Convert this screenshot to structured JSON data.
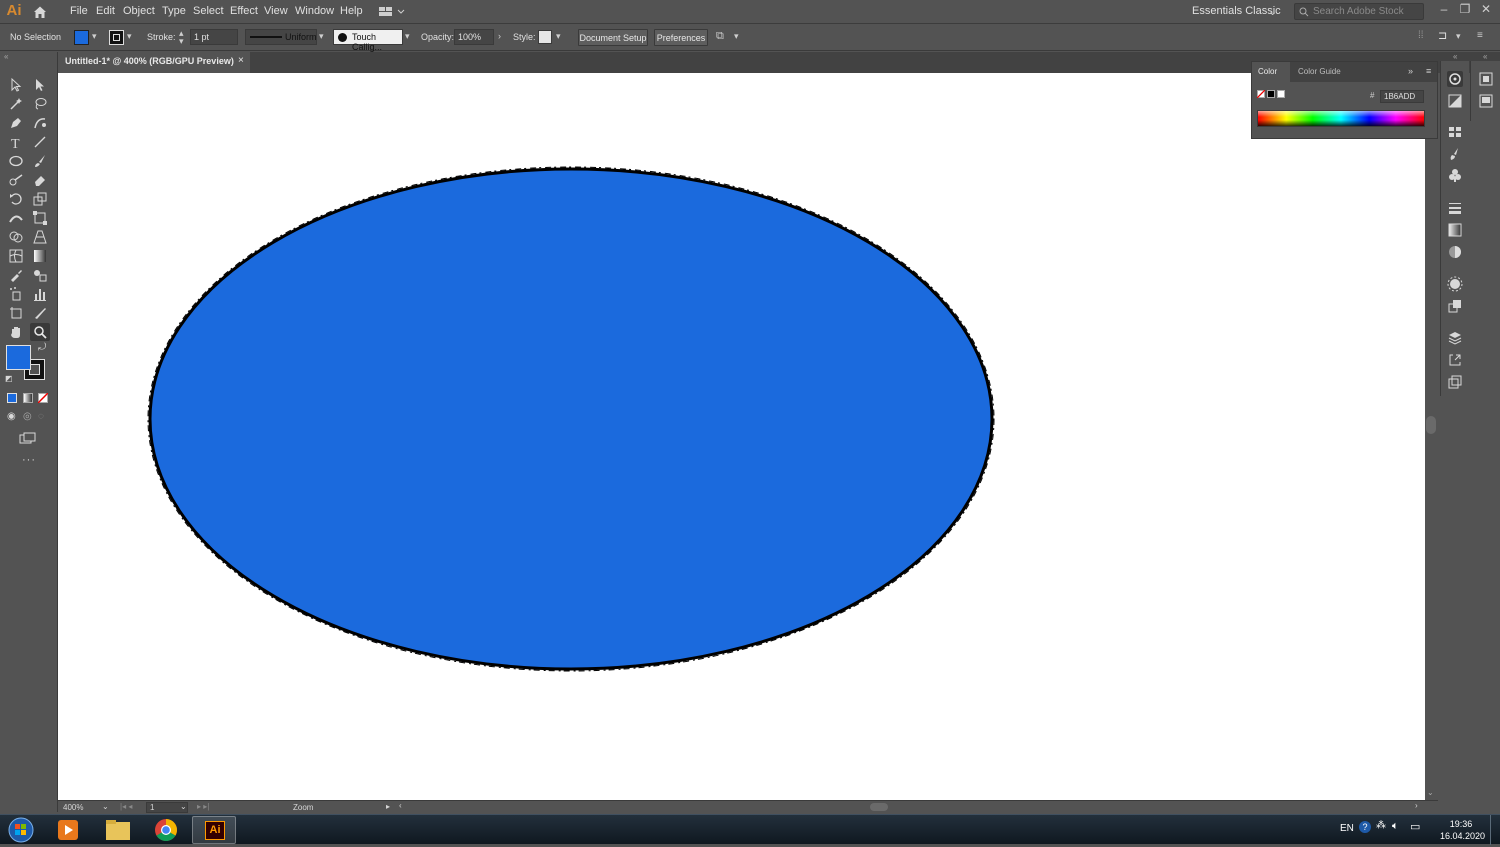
{
  "app": {
    "logo_text": "Ai",
    "menu": [
      "File",
      "Edit",
      "Object",
      "Type",
      "Select",
      "Effect",
      "View",
      "Window",
      "Help"
    ],
    "workspace": "Essentials Classic",
    "search_placeholder": "Search Adobe Stock"
  },
  "control_bar": {
    "selection_label": "No Selection",
    "fill_color": "#1B6ADD",
    "stroke_label": "Stroke:",
    "stroke_weight": "1 pt",
    "stroke_profile": "Uniform",
    "brush": "Touch Callig...",
    "opacity_label": "Opacity:",
    "opacity_value": "100%",
    "style_label": "Style:",
    "document_setup": "Document Setup",
    "preferences": "Preferences"
  },
  "document": {
    "tab_title": "Untitled-1* @ 400% (RGB/GPU Preview)",
    "close_glyph": "×",
    "shape_fill": "#1B6ADD",
    "shape_stroke": "#000000"
  },
  "status_bar": {
    "zoom": "400%",
    "artboard": "1",
    "tool_name": "Zoom"
  },
  "color_panel": {
    "tab_color": "Color",
    "tab_guide": "Color Guide",
    "hex_label": "#",
    "hex_value": "1B6ADD"
  },
  "taskbar": {
    "lang": "EN",
    "time": "19:36",
    "date": "16.04.2020",
    "active_app_label": "Ai"
  }
}
